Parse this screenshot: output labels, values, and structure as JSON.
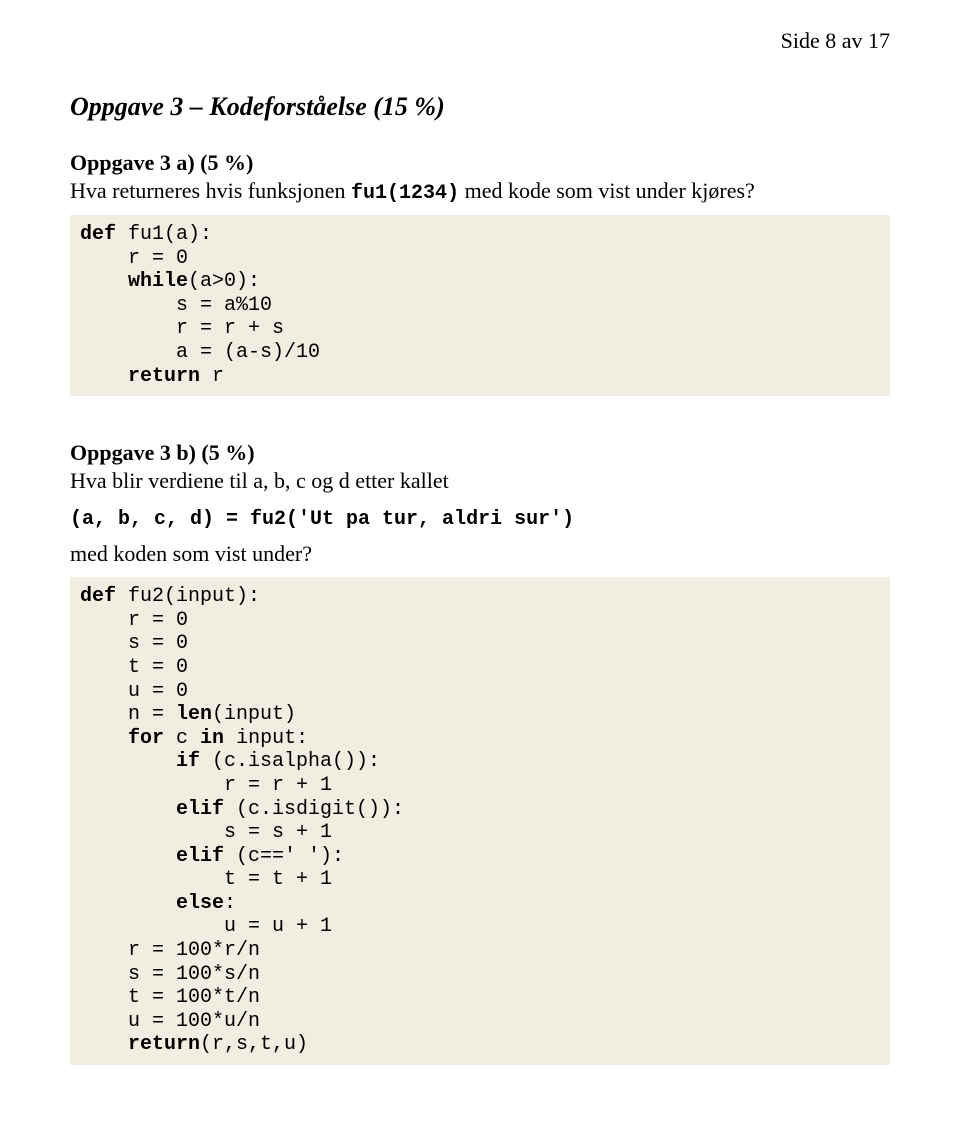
{
  "header": {
    "page_info": "Side 8 av 17"
  },
  "task3": {
    "title": "Oppgave 3 – Kodeforståelse (15 %)",
    "a": {
      "subtitle": "Oppgave 3 a) (5 %)",
      "prompt_pre": "Hva returneres hvis funksjonen ",
      "prompt_code": "fu1(1234)",
      "prompt_post": " med kode som vist under kjøres?"
    },
    "b": {
      "subtitle": "Oppgave 3 b) (5 %)",
      "prompt_line1": "Hva blir verdiene til a, b, c og d etter kallet",
      "prompt_line2_code": "(a, b, c, d) = fu2('Ut pa tur, aldri sur')",
      "prompt_line3": "med koden som vist under?"
    }
  },
  "code1": {
    "l1a": "def",
    "l1b": " fu1(a):",
    "l2": "    r = 0",
    "l3a": "    ",
    "l3b": "while",
    "l3c": "(a>0):",
    "l4": "        s = a%10",
    "l5": "        r = r + s",
    "l6": "        a = (a-s)/10",
    "l7a": "    ",
    "l7b": "return",
    "l7c": " r"
  },
  "code2": {
    "l1a": "def",
    "l1b": " fu2(input):",
    "l2": "    r = 0",
    "l3": "    s = 0",
    "l4": "    t = 0",
    "l5": "    u = 0",
    "l6a": "    n = ",
    "l6b": "len",
    "l6c": "(input)",
    "l7a": "    ",
    "l7b": "for",
    "l7c": " c ",
    "l7d": "in",
    "l7e": " input:",
    "l8a": "        ",
    "l8b": "if",
    "l8c": " (c.isalpha()):",
    "l9": "            r = r + 1",
    "l10a": "        ",
    "l10b": "elif",
    "l10c": " (c.isdigit()):",
    "l11": "            s = s + 1",
    "l12a": "        ",
    "l12b": "elif",
    "l12c": " (c==' '):",
    "l13": "            t = t + 1",
    "l14a": "        ",
    "l14b": "else",
    "l14c": ":",
    "l15": "            u = u + 1",
    "l16": "    r = 100*r/n",
    "l17": "    s = 100*s/n",
    "l18": "    t = 100*t/n",
    "l19": "    u = 100*u/n",
    "l20a": "    ",
    "l20b": "return",
    "l20c": "(r,s,t,u)"
  }
}
